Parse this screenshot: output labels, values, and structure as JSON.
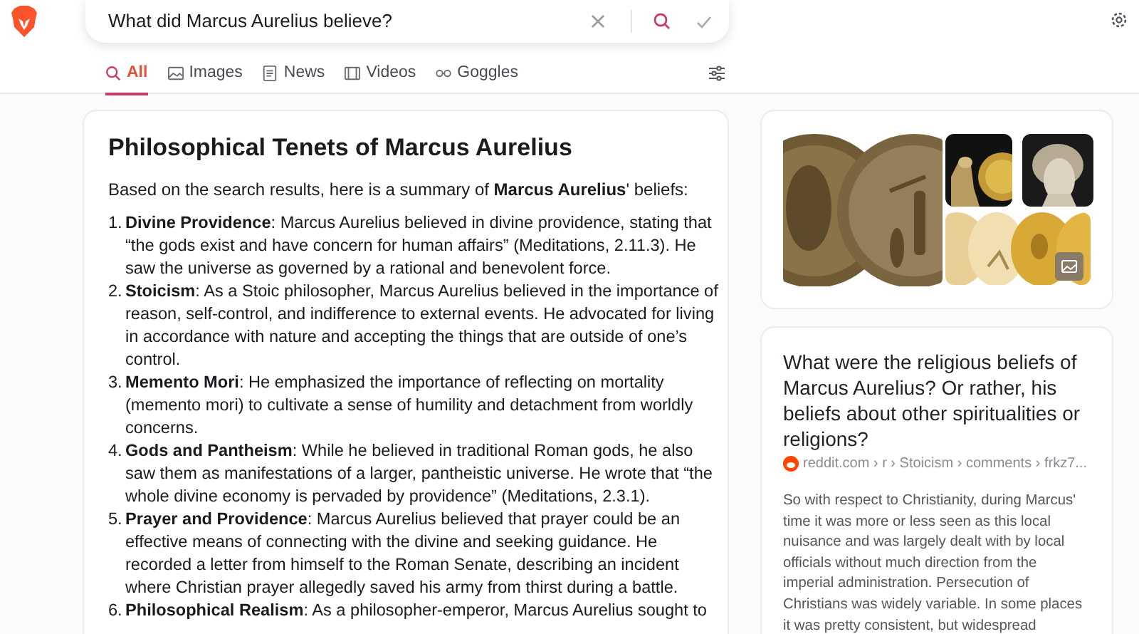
{
  "search": {
    "value": "What did Marcus Aurelius believe?"
  },
  "tabs": [
    {
      "label": "All",
      "selected": true
    },
    {
      "label": "Images",
      "selected": false
    },
    {
      "label": "News",
      "selected": false
    },
    {
      "label": "Videos",
      "selected": false
    },
    {
      "label": "Goggles",
      "selected": false
    }
  ],
  "answer": {
    "title": "Philosophical Tenets of Marcus Aurelius",
    "intro": "Based on the search results, here is a summary of **Marcus Aurelius**' beliefs:",
    "items": [
      {
        "number": "1.",
        "text": "**Divine Providence**: Marcus Aurelius believed in divine providence, stating that “the gods exist and have concern for human affairs” (Meditations, 2.11.3). He saw the universe as governed by a rational and benevolent force."
      },
      {
        "number": "2.",
        "text": "**Stoicism**: As a Stoic philosopher, Marcus Aurelius believed in the importance of reason, self-control, and indifference to external events. He advocated for living in accordance with nature and accepting the things that are outside of one’s control."
      },
      {
        "number": "3.",
        "text": "**Memento Mori**: He emphasized the importance of reflecting on mortality (memento mori) to cultivate a sense of humility and detachment from worldly concerns."
      },
      {
        "number": "4.",
        "text": "**Gods and Pantheism**: While he believed in traditional Roman gods, he also saw them as manifestations of a larger, pantheistic universe. He wrote that “the whole divine economy is pervaded by providence” (Meditations, 2.3.1)."
      },
      {
        "number": "5.",
        "text": "**Prayer and Providence**: Marcus Aurelius believed that prayer could be an effective means of connecting with the divine and seeking guidance. He recorded a letter from himself to the Roman Senate, describing an incident where Christian prayer allegedly saved his army from thirst during a battle."
      },
      {
        "number": "6.",
        "text": "**Philosophical Realism**: As a philosopher-emperor, Marcus Aurelius sought to"
      }
    ]
  },
  "result": {
    "title": "What were the religious beliefs of Marcus Aurelius? Or rather, his beliefs about other spiritualities or religions?",
    "source": "reddit.com › r › Stoicism › comments › frkz7...",
    "snippet": "So with respect to Christianity, during Marcus' time it was more or less seen as this local nuisance and was largely dealt with by local officials without much direction from the imperial administration. Persecution of Christians was widely variable. In some places it was pretty consistent, but widespread"
  }
}
